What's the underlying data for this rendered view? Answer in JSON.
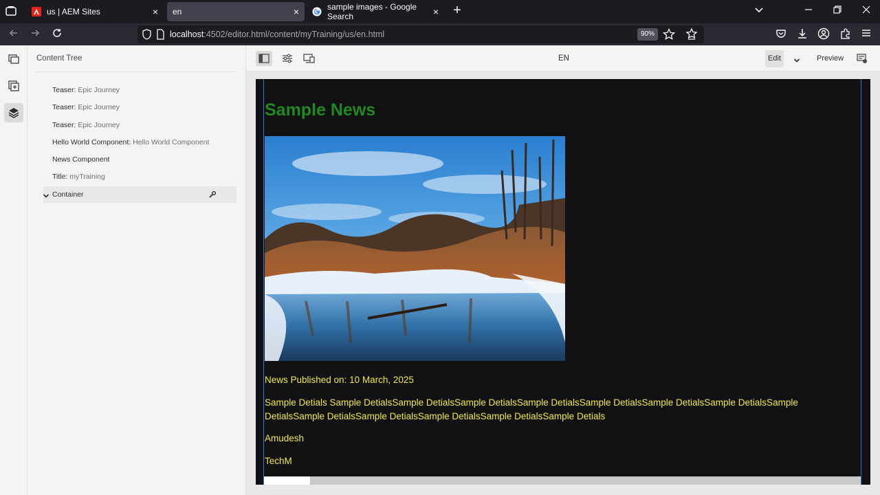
{
  "browser": {
    "tabs": [
      {
        "title": "us | AEM Sites",
        "close": "×"
      },
      {
        "title": "en",
        "close": "×"
      },
      {
        "title": "sample images - Google Search",
        "close": "×"
      }
    ],
    "new_tab": "+",
    "url_host": "localhost",
    "url_path": ":4502/editor.html/content/myTraining/us/en.html",
    "zoom": "90%"
  },
  "editor": {
    "panel_title": "Content Tree",
    "tree": [
      {
        "label": "Teaser:",
        "sub": " Epic Journey"
      },
      {
        "label": "Teaser:",
        "sub": " Epic Journey"
      },
      {
        "label": "Teaser:",
        "sub": " Epic Journey"
      },
      {
        "label": "Hello World Component:",
        "sub": " Hello World Component"
      },
      {
        "label": "News Component",
        "sub": ""
      },
      {
        "label": "Title:",
        "sub": " myTraining"
      },
      {
        "label": "Container",
        "sub": ""
      }
    ],
    "language": "EN",
    "edit_label": "Edit",
    "preview_label": "Preview"
  },
  "page_content": {
    "headline": "Sample News",
    "published": "News Published on: 10 March, 2025",
    "details": "Sample Detials Sample DetialsSample DetialsSample DetialsSample DetialsSample DetialsSample DetialsSample DetialsSample DetialsSample DetialsSample DetialsSample DetialsSample DetialsSample Detials",
    "author": "Amudesh",
    "company": "TechM"
  },
  "colors": {
    "headline": "#1f8a1f",
    "body_text": "#f2ea3a",
    "page_bg": "#111114",
    "selection_outline": "#2c7ad6"
  }
}
